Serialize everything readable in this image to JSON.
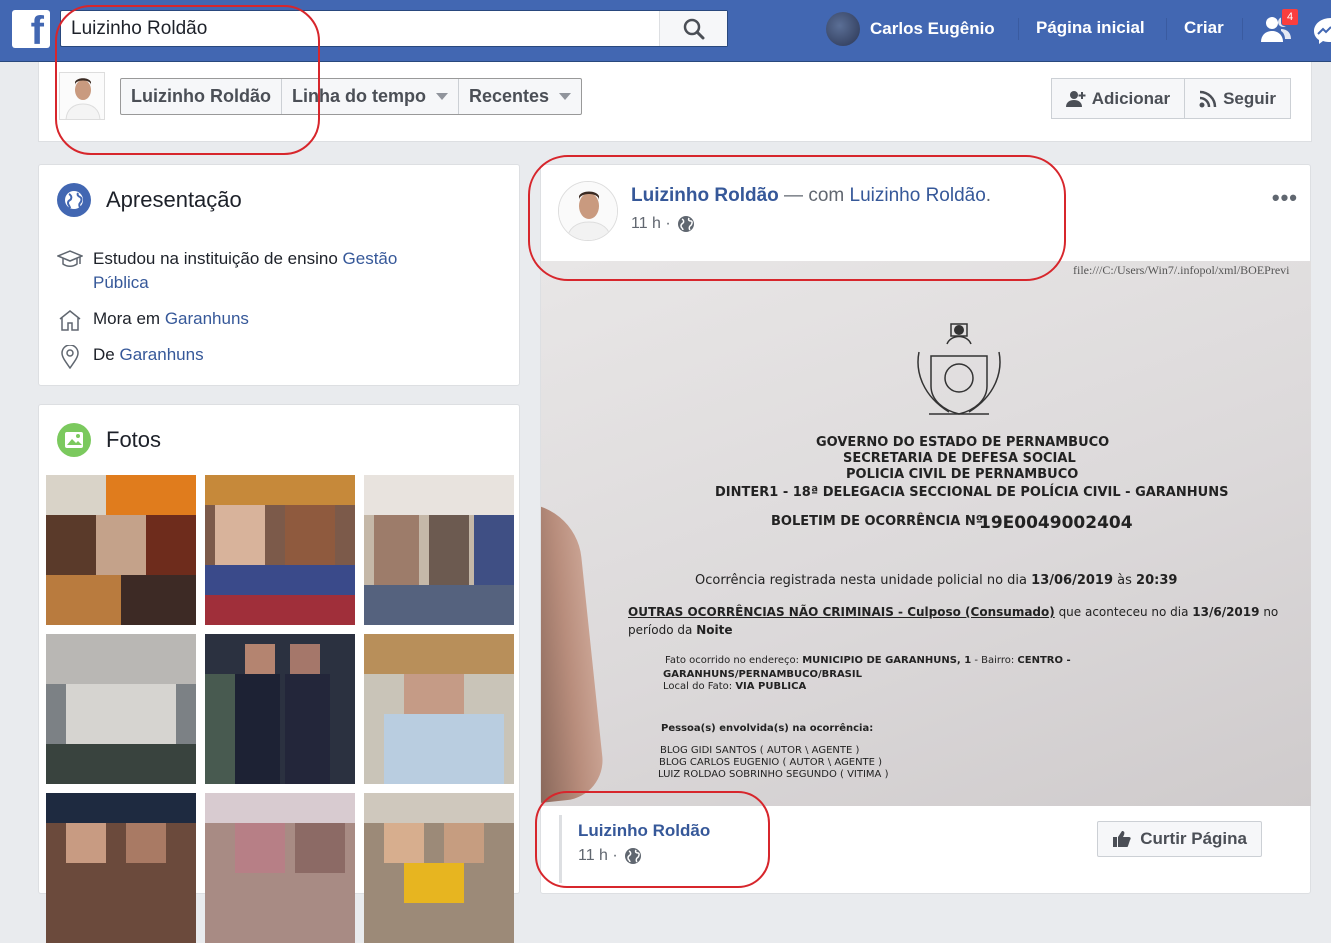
{
  "topbar": {
    "logo_letter": "f",
    "search_value": "Luizinho Roldão",
    "user_name": "Carlos Eugênio",
    "home_label": "Página inicial",
    "create_label": "Criar",
    "friend_requests_count": "4"
  },
  "profile_strip": {
    "tabs": [
      "Luizinho Roldão",
      "Linha do tempo",
      "Recentes"
    ],
    "add_label": "Adicionar",
    "follow_label": "Seguir"
  },
  "intro": {
    "title": "Apresentação",
    "studied_prefix": "Estudou na instituição de ensino",
    "studied_link_1": "Gestão",
    "studied_link_2": "Pública",
    "lives_prefix": "Mora em",
    "lives_link": "Garanhuns",
    "from_prefix": "De",
    "from_link": "Garanhuns"
  },
  "photos": {
    "title": "Fotos"
  },
  "post": {
    "author": "Luizinho Roldão",
    "with_text": "— com",
    "with_person": "Luizinho Roldão",
    "with_suffix": ".",
    "time": "11 h ·",
    "document": {
      "url": "file:///C:/Users/Win7/.infopol/xml/BOEPrevi",
      "line1": "GOVERNO DO ESTADO DE PERNAMBUCO",
      "line2": "SECRETARIA DE DEFESA SOCIAL",
      "line3": "POLICIA CIVIL DE PERNAMBUCO",
      "line4": "DINTER1 - 18ª DELEGACIA SECCIONAL DE POLÍCIA CIVIL - GARANHUNS",
      "bo_label": "BOLETIM DE OCORRÊNCIA Nº.",
      "bo_number": "19E0049002404",
      "registered_prefix": "Ocorrência registrada nesta unidade policial no dia",
      "registered_date": "13/06/2019",
      "registered_at": "às",
      "registered_time": "20:39",
      "type_text": "OUTRAS OCORRÊNCIAS NÃO CRIMINAIS - Culposo (Consumado)",
      "happened_text": "que aconteceu no dia",
      "happened_date": "13/6/2019",
      "happened_no": "no",
      "period_prefix": "período da",
      "period": "Noite",
      "address_label": "Fato ocorrido no endereço:",
      "address_value": "MUNICIPIO DE GARANHUNS, 1",
      "bairro_label": "- Bairro:",
      "bairro_value": "CENTRO -",
      "address_line2": "GARANHUNS/PERNAMBUCO/BRASIL",
      "local_label": "Local do Fato:",
      "local_value": "VIA PUBLICA",
      "people_label": "Pessoa(s) envolvida(s) na ocorrência:",
      "person1": "BLOG GIDI SANTOS ( AUTOR \\ AGENTE )",
      "person2": "BLOG CARLOS EUGENIO ( AUTOR \\ AGENTE )",
      "person3": "LUIZ ROLDAO SOBRINHO SEGUNDO ( VITIMA )"
    },
    "footer_author": "Luizinho Roldão",
    "footer_time": "11 h ·",
    "like_page_label": "Curtir Página"
  }
}
